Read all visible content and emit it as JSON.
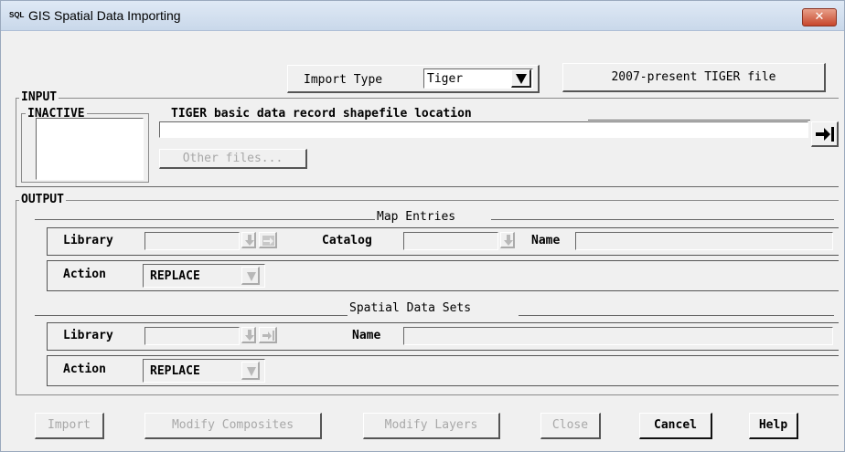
{
  "window": {
    "title": "GIS Spatial Data Importing",
    "icon_text": "SQL",
    "close_glyph": "✕"
  },
  "import_type": {
    "label": "Import Type",
    "value": "Tiger",
    "format_button": "2007-present TIGER file"
  },
  "input": {
    "frame_label": "INPUT",
    "inactive_label": "INACTIVE",
    "file_location_label": "TIGER basic data record shapefile location",
    "file_location_value": "",
    "other_files_button": "Other files..."
  },
  "output": {
    "frame_label": "OUTPUT",
    "map_entries": {
      "heading": "Map Entries",
      "library_label": "Library",
      "library_value": "",
      "catalog_label": "Catalog",
      "catalog_value": "",
      "name_label": "Name",
      "name_value": "",
      "action_label": "Action",
      "action_value": "REPLACE"
    },
    "spatial_data_sets": {
      "heading": "Spatial Data Sets",
      "library_label": "Library",
      "library_value": "",
      "name_label": "Name",
      "name_value": "",
      "action_label": "Action",
      "action_value": "REPLACE"
    }
  },
  "buttons": {
    "import": "Import",
    "modify_composites": "Modify Composites",
    "modify_layers": "Modify Layers",
    "close": "Close",
    "cancel": "Cancel",
    "help": "Help"
  }
}
